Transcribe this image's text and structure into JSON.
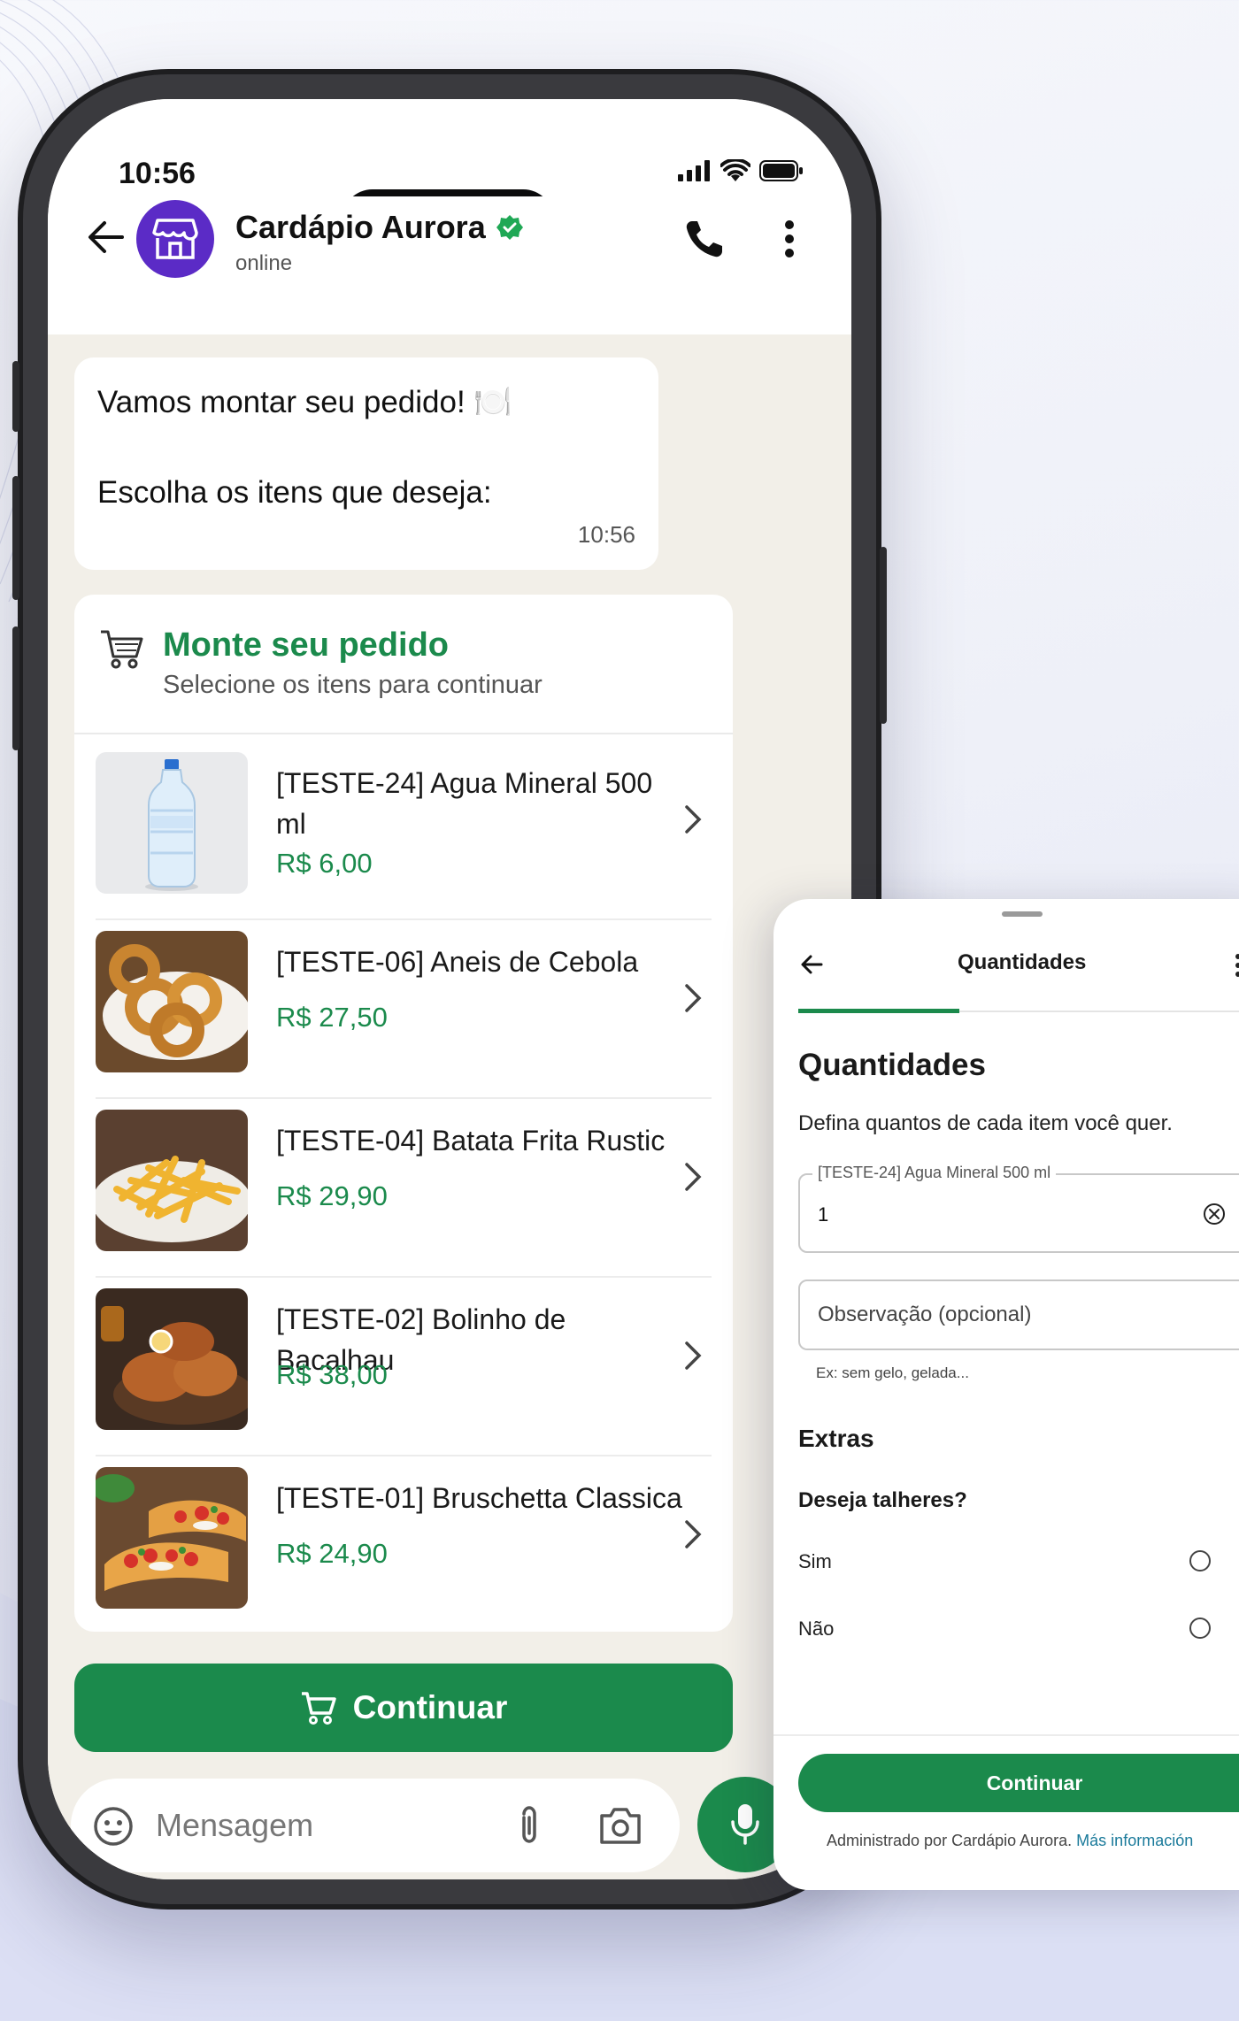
{
  "status_bar": {
    "time": "10:56"
  },
  "chat": {
    "contact_name": "Cardápio Aurora",
    "contact_status": "online",
    "icons": [
      "back-arrow-icon",
      "store-icon",
      "verified-badge-icon",
      "phone-icon",
      "kebab-menu-icon"
    ]
  },
  "message": {
    "line1": "Vamos montar seu pedido! 🍽️",
    "line2": "Escolha os itens que deseja:",
    "time": "10:56"
  },
  "order_card": {
    "title": "Monte seu pedido",
    "subtitle": "Selecione os itens para continuar",
    "items": [
      {
        "name": "[TESTE-24] Agua Mineral 500 ml",
        "price": "R$ 6,00",
        "image": "water-bottle"
      },
      {
        "name": "[TESTE-06] Aneis de Cebola",
        "price": "R$ 27,50",
        "image": "onion-rings"
      },
      {
        "name": "[TESTE-04] Batata Frita Rustic",
        "price": "R$ 29,90",
        "image": "french-fries"
      },
      {
        "name": "[TESTE-02] Bolinho de Bacalhau",
        "price": "R$ 38,00",
        "image": "cod-fritters"
      },
      {
        "name": "[TESTE-01] Bruschetta Classica",
        "price": "R$ 24,90",
        "image": "bruschetta"
      }
    ],
    "continue_label": "Continuar"
  },
  "composer": {
    "placeholder": "Mensagem"
  },
  "sheet": {
    "nav_title": "Quantidades",
    "heading": "Quantidades",
    "description": "Defina quantos de cada item você quer.",
    "quantity_field": {
      "label": "[TESTE-24] Agua Mineral 500 ml",
      "value": "1"
    },
    "note_field": {
      "placeholder": "Observação (opcional)",
      "hint": "Ex: sem gelo, gelada..."
    },
    "extras_title": "Extras",
    "question": "Deseja talheres?",
    "options": [
      "Sim",
      "Não"
    ],
    "continue_label": "Continuar",
    "footer_text": "Administrado por Cardápio Aurora.",
    "footer_link": "Más información"
  },
  "colors": {
    "brand_green": "#1b8a4c",
    "avatar_purple": "#5b2bc6"
  }
}
